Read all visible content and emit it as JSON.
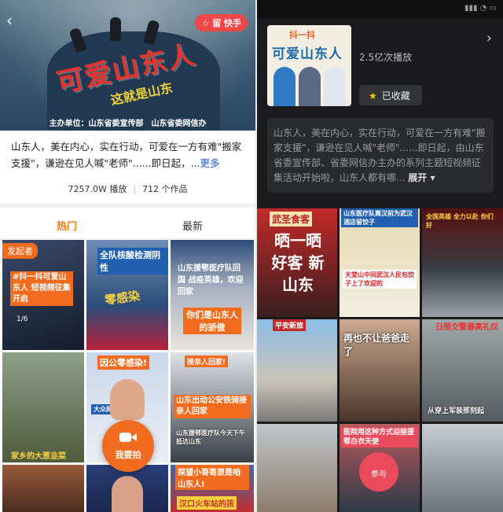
{
  "left": {
    "banner": {
      "title": "可爱山东人",
      "subtitle": "这就是山东",
      "organizers": "主办单位：山东省委宣传部　山东省委网信办",
      "favorite_label": "留 快手"
    },
    "description": "山东人，美在内心，实在行动，可爱在一方有难\"搬家支援\"，谦逊在见人喊\"老师\"......即日起，...",
    "more_label": "更多",
    "stats": {
      "plays": "7257.0W 播放",
      "works": "712 个作品"
    },
    "tabs": [
      "热门",
      "最新"
    ],
    "grid": {
      "origin_tag": "发起者",
      "slide_count": "1/6",
      "captions": [
        "#抖一抖可爱山东人 短视频征集开启",
        "全队核酸检测阴性",
        "山东援鄂医疗队回国 战疫英雄，欢迎回家",
        "零感染",
        "你们是山东人的骄傲",
        "因公零感染!",
        "大众网快讯",
        "山东出动公安铁骑接亲人回家",
        "山东援鄂医疗队今天下午抵达山东",
        "家乡的大葱韭菜",
        "探望小哥哥原是咱山东人!",
        "汉口火车站的孩"
      ],
      "record_label": "我要拍"
    }
  },
  "right": {
    "cover": {
      "line1": "抖一抖",
      "line2": "可爱山东人"
    },
    "plays": "2.5亿次播放",
    "collected_label": "已收藏",
    "description": "山东人，美在内心，实在行动，可爱在一方有难\"搬家支援\"，谦逊在见人喊\"老师\"......即日起，由山东省委宣传部、省委网信办主办的系列主题短视频征集活动开始啦，山东人都有哪...",
    "expand_label": "展开",
    "grid": {
      "captions": [
        "武圣食客",
        "晒一晒 好客 新山东",
        "山东医疗队离汉前为武汉酒店留饺子",
        "天堂山中间武汉人民包饺子上了欢迎的",
        "全国英雄 全力以赴 你们好",
        "平安新旅",
        "再也不让爸爸走了",
        "日照交警最高礼仪",
        "从穿上军装那刻起",
        "医院用这种方式迎接援鄂白衣天使",
        "参与"
      ]
    }
  }
}
